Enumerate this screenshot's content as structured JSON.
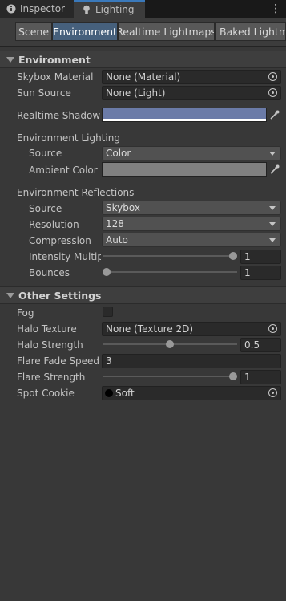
{
  "window_tabs": [
    {
      "label": "Inspector",
      "icon": "info-icon",
      "active": false
    },
    {
      "label": "Lighting",
      "icon": "lightbulb-icon",
      "active": true
    }
  ],
  "toolbar_tabs": [
    {
      "label": "Scene",
      "selected": false
    },
    {
      "label": "Environment",
      "selected": true
    },
    {
      "label": "Realtime Lightmaps",
      "selected": false
    },
    {
      "label": "Baked Lightmaps",
      "selected": false
    }
  ],
  "environment": {
    "title": "Environment",
    "skybox_material": {
      "label": "Skybox Material",
      "value": "None (Material)"
    },
    "sun_source": {
      "label": "Sun Source",
      "value": "None (Light)"
    },
    "realtime_shadow": {
      "label": "Realtime Shadow Color",
      "color": "#6b7ba8"
    },
    "lighting": {
      "title": "Environment Lighting",
      "source": {
        "label": "Source",
        "value": "Color"
      },
      "ambient": {
        "label": "Ambient Color",
        "color": "#808080"
      }
    },
    "reflections": {
      "title": "Environment Reflections",
      "source": {
        "label": "Source",
        "value": "Skybox"
      },
      "resolution": {
        "label": "Resolution",
        "value": "128"
      },
      "compression": {
        "label": "Compression",
        "value": "Auto"
      },
      "intensity": {
        "label": "Intensity Multiplier",
        "value": "1",
        "fraction": 1.0
      },
      "bounces": {
        "label": "Bounces",
        "value": "1",
        "fraction": 0.0
      }
    }
  },
  "other": {
    "title": "Other Settings",
    "fog": {
      "label": "Fog",
      "checked": false
    },
    "halo_texture": {
      "label": "Halo Texture",
      "value": "None (Texture 2D)"
    },
    "halo_strength": {
      "label": "Halo Strength",
      "value": "0.5",
      "fraction": 0.5
    },
    "flare_fade": {
      "label": "Flare Fade Speed",
      "value": "3"
    },
    "flare_strength": {
      "label": "Flare Strength",
      "value": "1",
      "fraction": 1.0
    },
    "spot_cookie": {
      "label": "Spot Cookie",
      "value": "Soft"
    }
  },
  "colors": {
    "accent": "#3a79bb",
    "selected_tab": "#46607c",
    "background": "#383838"
  }
}
